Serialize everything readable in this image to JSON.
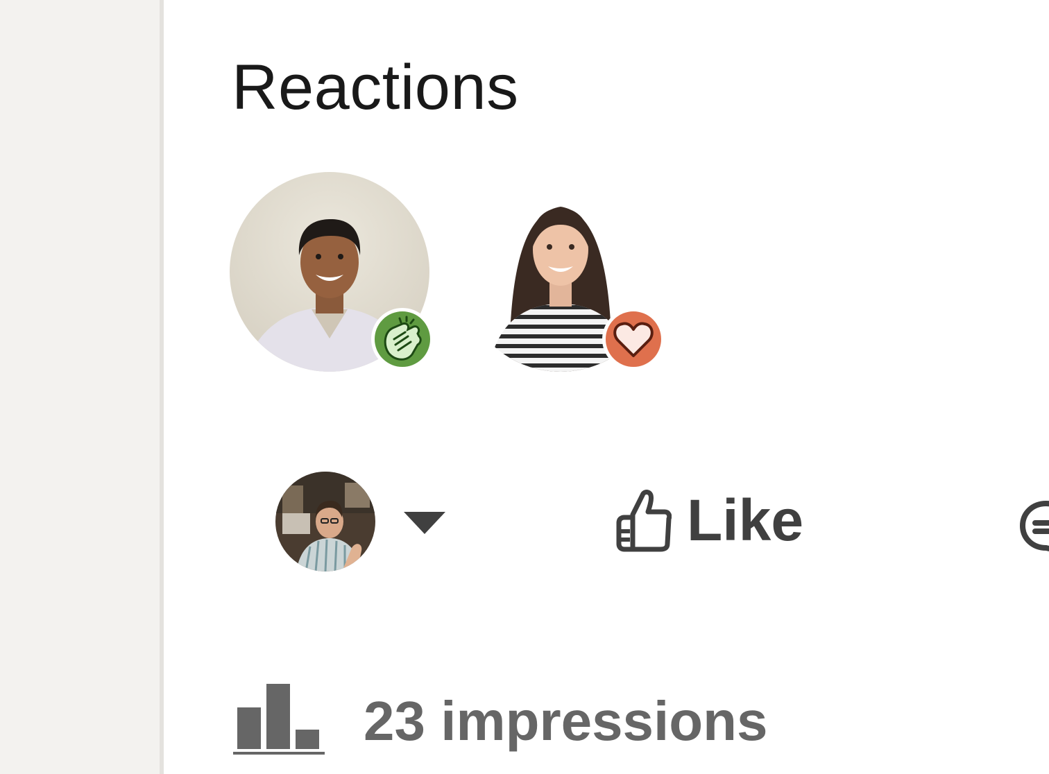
{
  "reactions": {
    "title": "Reactions",
    "people": [
      {
        "reaction": "celebrate",
        "reaction_icon": "clapping-hands-icon",
        "badge_color": "#5f9b41"
      },
      {
        "reaction": "love",
        "reaction_icon": "heart-icon",
        "badge_color": "#df704d"
      }
    ]
  },
  "actions": {
    "like_label": "Like"
  },
  "impressions": {
    "label": "23 impressions",
    "icon": "bar-chart-icon"
  },
  "colors": {
    "background": "#ffffff",
    "rail": "#f3f2ef",
    "text_primary": "#191919",
    "text_action": "#404040",
    "text_muted": "#666666"
  }
}
